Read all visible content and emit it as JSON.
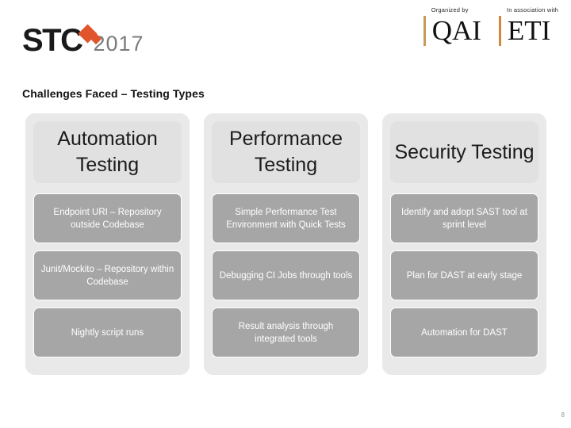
{
  "header": {
    "logo": {
      "brand": "STC",
      "year": "2017"
    },
    "partners": [
      {
        "caption": "Organized by",
        "name": "QAI"
      },
      {
        "caption": "In association with",
        "name": "ETI"
      }
    ]
  },
  "slide": {
    "title": "Challenges Faced – Testing Types",
    "page_number": "8",
    "columns": [
      {
        "heading": "Automation Testing",
        "items": [
          "Endpoint URI – Repository outside Codebase",
          "Junit/Mockito – Repository within Codebase",
          "Nightly script runs"
        ]
      },
      {
        "heading": "Performance Testing",
        "items": [
          "Simple Performance Test Environment with Quick Tests",
          "Debugging CI Jobs through tools",
          "Result analysis through integrated tools"
        ]
      },
      {
        "heading": "Security Testing",
        "items": [
          "Identify and adopt SAST tool at sprint level",
          "Plan for DAST at early stage",
          "Automation for DAST"
        ]
      }
    ]
  },
  "colors": {
    "accent_orange": "#e0552c",
    "partner_rule": "#c79a58",
    "column_panel": "#e9e9e9",
    "column_header": "#e1e1e1",
    "cell_fill": "#a6a6a6",
    "title_text": "#111111"
  }
}
